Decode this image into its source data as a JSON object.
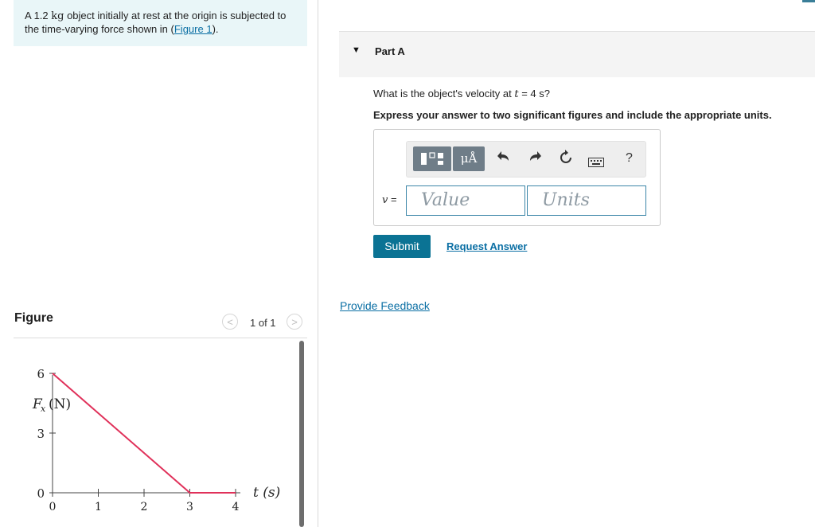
{
  "problem": {
    "text_before_mass": "A 1.2 ",
    "mass_unit": "kg",
    "text_after_mass": " object initially at rest at the origin is subjected to the time-varying force shown in (",
    "figure_link": "Figure 1",
    "text_end": ")."
  },
  "figure": {
    "title": "Figure",
    "pager_count": "1 of 1",
    "prev_symbol": "<",
    "next_symbol": ">"
  },
  "chart_data": {
    "type": "line",
    "ylabel": "Fx (N)",
    "ylabel_main": "F",
    "ylabel_sub": "x",
    "ylabel_unit": "(N)",
    "xlabel": "t (s)",
    "x_ticks": [
      "0",
      "1",
      "2",
      "3",
      "4"
    ],
    "y_ticks": [
      "0",
      "3",
      "6"
    ],
    "xlim": [
      0,
      4
    ],
    "ylim": [
      0,
      6
    ],
    "series": [
      {
        "x": [
          0,
          3,
          4
        ],
        "y": [
          6,
          0,
          0
        ],
        "color": "#e0315a"
      }
    ]
  },
  "part": {
    "caret": "▼",
    "title": "Part A",
    "question_prefix": "What is the object's velocity at ",
    "question_var": "t",
    "question_suffix": " = 4 s?",
    "instruction": "Express your answer to two significant figures and include the appropriate units."
  },
  "toolbar": {
    "mu_label": "μÅ",
    "undo_icon": "undo-arrow-icon",
    "redo_icon": "redo-arrow-icon",
    "reset_icon": "reset-icon",
    "keyboard_icon": "keyboard-icon",
    "help_label": "?"
  },
  "answer": {
    "var_symbol": "v",
    "equals": " =",
    "value_placeholder": "Value",
    "units_placeholder": "Units"
  },
  "actions": {
    "submit_label": "Submit",
    "request_answer_label": "Request Answer",
    "feedback_label": "Provide Feedback"
  },
  "colors": {
    "accent": "#0b7394",
    "link": "#0b6fa4",
    "problem_bg": "#e9f6f8",
    "series": "#e0315a"
  }
}
